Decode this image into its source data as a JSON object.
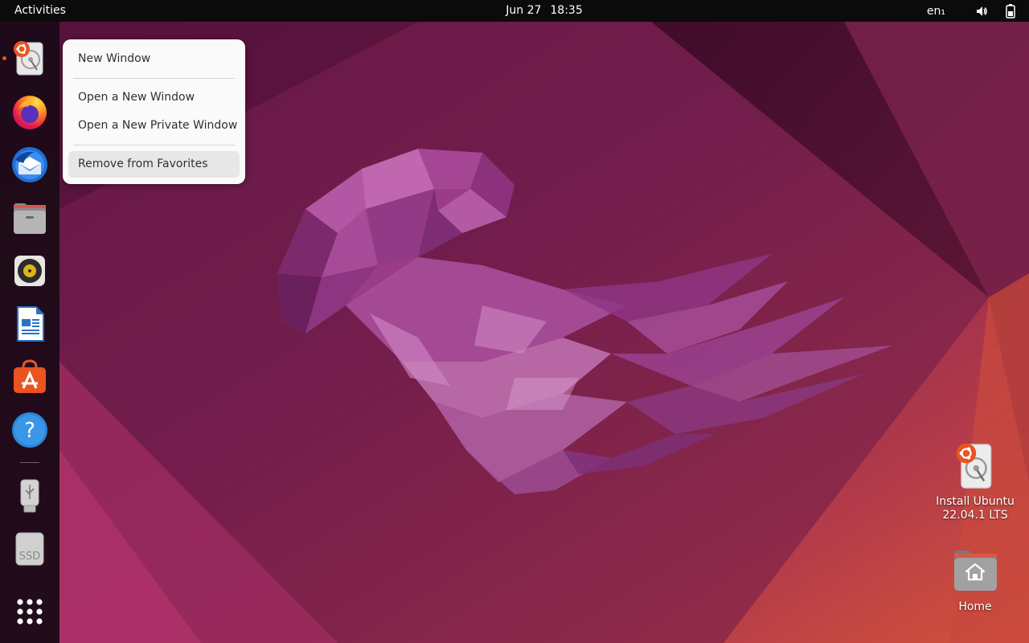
{
  "topbar": {
    "activities": "Activities",
    "date": "Jun 27",
    "time": "18:35",
    "language": "en₁"
  },
  "dock": {
    "items": [
      {
        "name": "Install Ubuntu 22.04.1 LTS",
        "icon": "ubuntu-installer-icon"
      },
      {
        "name": "Firefox Web Browser",
        "icon": "firefox-icon"
      },
      {
        "name": "Thunderbird Mail",
        "icon": "thunderbird-icon"
      },
      {
        "name": "Files",
        "icon": "files-icon"
      },
      {
        "name": "Rhythmbox",
        "icon": "rhythmbox-icon"
      },
      {
        "name": "LibreOffice Writer",
        "icon": "libreoffice-writer-icon"
      },
      {
        "name": "Ubuntu Software",
        "icon": "ubuntu-software-icon"
      },
      {
        "name": "Help",
        "icon": "help-icon"
      },
      {
        "name": "USB Drive",
        "icon": "usb-drive-icon"
      },
      {
        "name": "SSD",
        "icon": "ssd-drive-icon",
        "label": "SSD"
      },
      {
        "name": "Show Applications",
        "icon": "app-grid-icon"
      }
    ]
  },
  "context_menu": {
    "items": [
      {
        "label": "New Window"
      },
      {
        "label": "Open a New Window"
      },
      {
        "label": "Open a New Private Window"
      },
      {
        "label": "Remove from Favorites",
        "highlighted": true
      }
    ]
  },
  "desktop": {
    "icons": [
      {
        "label_line1": "Install Ubuntu",
        "label_line2": "22.04.1 LTS",
        "icon": "ubuntu-installer-icon"
      },
      {
        "label": "Home",
        "icon": "home-folder-icon"
      }
    ]
  },
  "colors": {
    "accent": "#e95420",
    "topbar": "#0b0b0b",
    "menu_bg": "#fafafa",
    "menu_hover": "#e7e7e7"
  }
}
